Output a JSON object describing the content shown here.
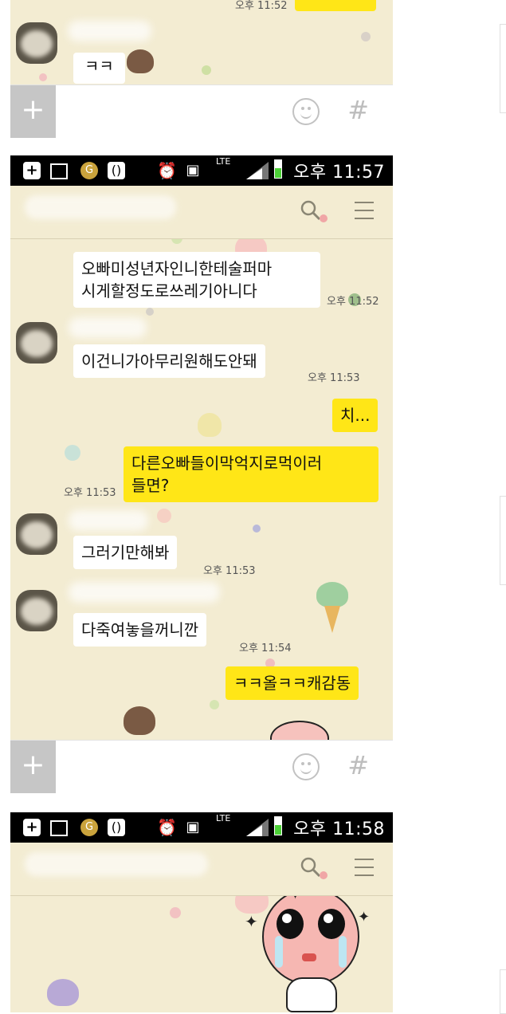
{
  "input_bar": {
    "plus_label": "+",
    "hash_label": "#"
  },
  "screen1": {
    "top_time": "오후 11:52",
    "message": "ㅋㅋ"
  },
  "screen2": {
    "status_time": "오후 11:57",
    "status_lte": "LTE",
    "messages": [
      {
        "text_line1": "오빠미성년자인니한테술퍼마",
        "text_line2": "시게할정도로쓰레기아니다",
        "time": "오후 11:52"
      },
      {
        "text": "이건니가아무리원해도안돼",
        "time": "오후 11:53"
      },
      {
        "text": "치..."
      },
      {
        "text_line1": "다른오빠들이막억지로먹이러",
        "text_line2": "들면?",
        "time": "오후 11:53"
      },
      {
        "text": "그러기만해봐",
        "time": "오후 11:53"
      },
      {
        "text": "다죽여놓을꺼니깐",
        "time": "오후 11:54"
      },
      {
        "text": "ㅋㅋ올ㅋㅋ캐감동"
      }
    ]
  },
  "screen3": {
    "status_time": "오후 11:58",
    "status_lte": "LTE"
  },
  "colors": {
    "wallpaper": "#f3ecd2",
    "my_bubble": "#ffe617",
    "their_bubble": "#ffffff",
    "status_bar": "#000000",
    "battery": "#4cd137"
  },
  "icons": [
    "search-icon",
    "menu-icon",
    "emoji-icon",
    "hash-icon",
    "plus-icon",
    "alarm-icon",
    "signal-icon",
    "battery-icon"
  ]
}
